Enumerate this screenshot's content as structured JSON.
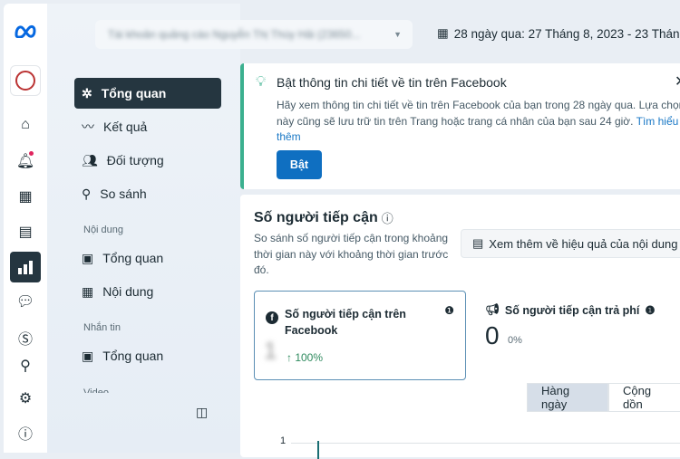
{
  "rail": {
    "items": [
      "home",
      "notifications",
      "ads-manager",
      "content",
      "insights",
      "messages",
      "billing",
      "search",
      "settings",
      "help"
    ]
  },
  "nav": {
    "items": [
      {
        "label": "Tổng quan",
        "icon": "overview-icon",
        "active": true
      },
      {
        "label": "Kết quả",
        "icon": "results-icon"
      },
      {
        "label": "Đối tượng",
        "icon": "audience-icon"
      },
      {
        "label": "So sánh",
        "icon": "compare-icon"
      }
    ],
    "sections": [
      {
        "title": "Nội dung",
        "items": [
          {
            "label": "Tổng quan"
          },
          {
            "label": "Nội dung"
          }
        ]
      },
      {
        "title": "Nhắn tin",
        "items": [
          {
            "label": "Tổng quan"
          }
        ]
      },
      {
        "title": "Video"
      }
    ]
  },
  "header": {
    "account": "Tài khoản quảng cáo Nguyễn Thị Thùy Hải (23650...",
    "date_range": "28 ngày qua: 27 Tháng 8, 2023 - 23 Tháng"
  },
  "banner": {
    "title": "Bật thông tin chi tiết về tin trên Facebook",
    "body": "Hãy xem thông tin chi tiết về tin trên Facebook của bạn trong 28 ngày qua. Lựa chọn này cũng sẽ lưu trữ tin trên Trang hoặc trang cá nhân của bạn sau 24 giờ.",
    "link": "Tìm hiểu thêm",
    "button": "Bật",
    "accent": "#3bb08f"
  },
  "reach": {
    "title": "Số người tiếp cận",
    "desc": "So sánh số người tiếp cận trong khoảng thời gian này với khoảng thời gian trước đó.",
    "more_button": "Xem thêm về hiệu quả của nội dung",
    "facebook": {
      "label": "Số người tiếp cận trên Facebook",
      "value": "1",
      "change": "↑ 100%"
    },
    "paid": {
      "label": "Số người tiếp cận trả phí",
      "value": "0",
      "change": "0%"
    },
    "toggle": [
      "Hàng ngày",
      "Cộng dồn"
    ],
    "y_tick": "1"
  }
}
